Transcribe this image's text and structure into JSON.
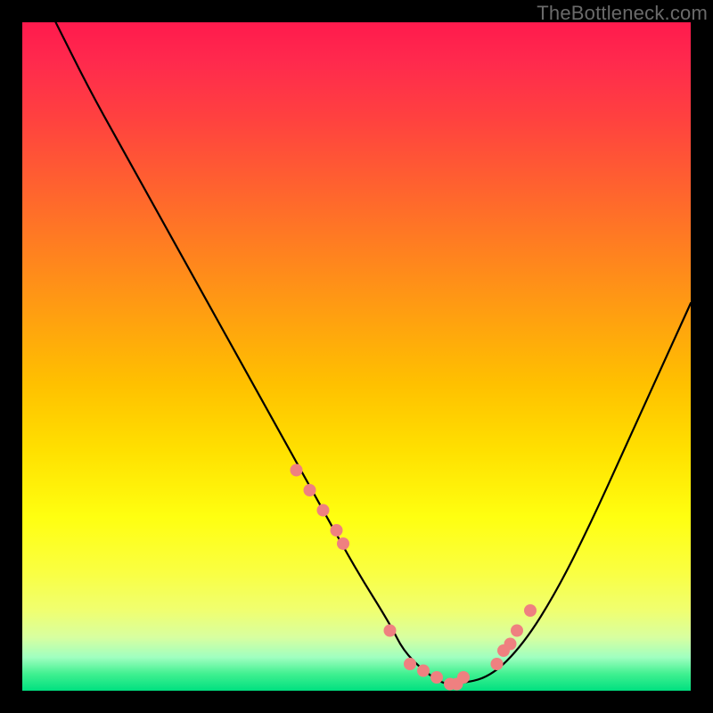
{
  "watermark": "TheBottleneck.com",
  "chart_data": {
    "type": "line",
    "title": "",
    "xlabel": "",
    "ylabel": "",
    "xlim": [
      0,
      100
    ],
    "ylim": [
      0,
      100
    ],
    "grid": false,
    "series": [
      {
        "name": "curve",
        "color": "#000000",
        "x": [
          5,
          10,
          15,
          20,
          25,
          30,
          35,
          40,
          45,
          50,
          55,
          57,
          60,
          63,
          65,
          70,
          75,
          80,
          85,
          90,
          95,
          100
        ],
        "y": [
          100,
          90,
          81,
          72,
          63,
          54,
          45,
          36,
          27,
          18,
          10,
          6,
          3,
          1,
          1,
          2,
          7,
          15,
          25,
          36,
          47,
          58
        ]
      }
    ],
    "markers": {
      "name": "highlight",
      "color": "#ef8080",
      "radius_px": 7,
      "x": [
        41,
        43,
        45,
        47,
        48,
        55,
        58,
        60,
        62,
        64,
        65,
        66,
        71,
        72,
        73,
        74,
        76
      ],
      "y": [
        33,
        30,
        27,
        24,
        22,
        9,
        4,
        3,
        2,
        1,
        1,
        2,
        4,
        6,
        7,
        9,
        12
      ]
    }
  }
}
